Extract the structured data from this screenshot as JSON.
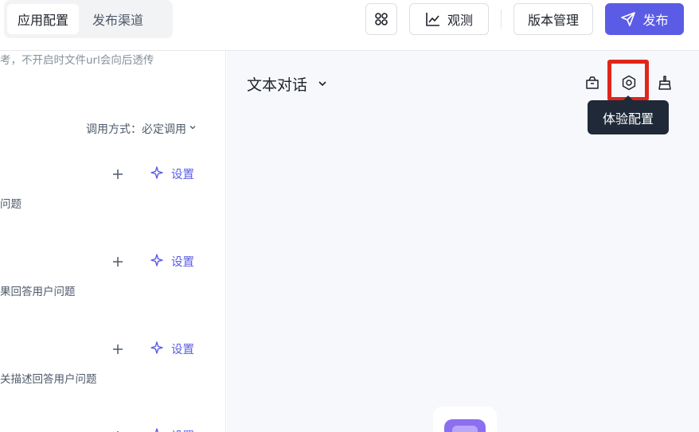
{
  "header": {
    "tabs": [
      {
        "label": "应用配置",
        "active": true
      },
      {
        "label": "发布渠道",
        "active": false
      }
    ],
    "observe_label": "观测",
    "version_label": "版本管理",
    "publish_label": "发布",
    "accent_color": "#5b5ce6"
  },
  "left": {
    "hint": "考，不开启时文件url会向后透传",
    "invoke_label": "调用方式：必定调用",
    "rows": [
      {
        "setting_label": "设置",
        "desc": "问题"
      },
      {
        "setting_label": "设置",
        "desc": "果回答用户问题"
      },
      {
        "setting_label": "设置",
        "desc": "关描述回答用户问题"
      },
      {
        "setting_label": "设置"
      }
    ]
  },
  "right": {
    "chat_title": "文本对话",
    "tooltip": "体验配置",
    "icons": [
      "bag-icon",
      "gear-icon",
      "broom-icon"
    ],
    "highlight_color": "#e0261b"
  }
}
